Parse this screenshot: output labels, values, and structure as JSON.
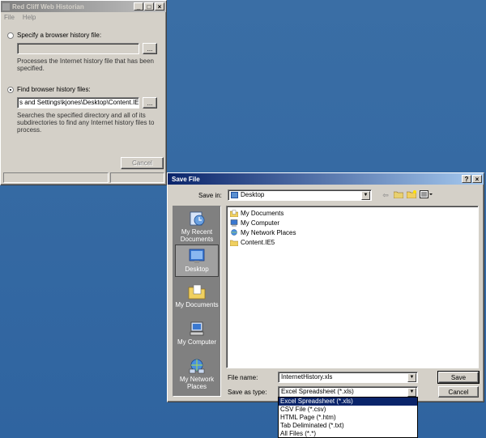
{
  "historian": {
    "title": "Red Cliff Web Historian",
    "menu": [
      "File",
      "Help"
    ],
    "option1": {
      "label": "Specify a browser history file:",
      "value": "",
      "browse": "...",
      "desc": "Processes the Internet history file that has been specified."
    },
    "option2": {
      "label": "Find  browser history files:",
      "value": "s and Settings\\kjones\\Desktop\\Content.IE5",
      "browse": "...",
      "desc": "Searches the specified directory and all of its subdirectories to find any Internet history files to process."
    },
    "cancel": "Cancel",
    "title_buttons": [
      "_",
      "□",
      "×"
    ]
  },
  "save_dialog": {
    "title": "Save File",
    "title_buttons": [
      "?",
      "×"
    ],
    "save_in_label": "Save in:",
    "save_in_value": "Desktop",
    "places": [
      {
        "label": "My Recent Documents",
        "icon": "recent-documents-icon"
      },
      {
        "label": "Desktop",
        "icon": "desktop-icon"
      },
      {
        "label": "My Documents",
        "icon": "my-documents-icon"
      },
      {
        "label": "My Computer",
        "icon": "my-computer-icon"
      },
      {
        "label": "My Network Places",
        "icon": "network-places-icon"
      }
    ],
    "files": [
      {
        "name": "My Documents",
        "icon": "folder-documents-icon"
      },
      {
        "name": "My Computer",
        "icon": "computer-icon"
      },
      {
        "name": "My Network Places",
        "icon": "network-icon"
      },
      {
        "name": "Content.IE5",
        "icon": "folder-icon"
      }
    ],
    "file_name_label": "File name:",
    "file_name_value": "InternetHistory.xls",
    "save_type_label": "Save as type:",
    "save_type_value": "Excel Spreadsheet (*.xls)",
    "save_button": "Save",
    "cancel_button": "Cancel",
    "type_options": [
      "Excel Spreadsheet (*.xls)",
      "CSV File (*.csv)",
      "HTML Page (*.htm)",
      "Tab Deliminated (*.txt)",
      "All Files (*.*)"
    ]
  }
}
